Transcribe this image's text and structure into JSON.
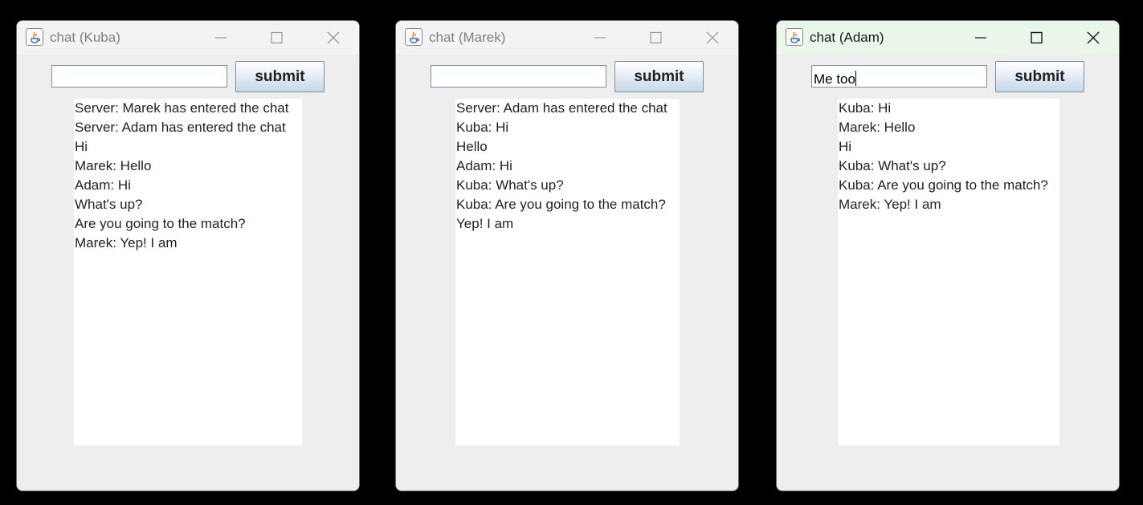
{
  "windows": [
    {
      "title": "chat (Kuba)",
      "input_value": "",
      "submit_label": "submit",
      "messages": [
        "Server: Marek has entered the chat",
        "Server: Adam has entered the chat",
        "Hi",
        "Marek: Hello",
        "Adam: Hi",
        "What's up?",
        "Are you going to the match?",
        "Marek: Yep! I am"
      ]
    },
    {
      "title": "chat (Marek)",
      "input_value": "",
      "submit_label": "submit",
      "messages": [
        "Server: Adam has entered the chat",
        "Kuba: Hi",
        "Hello",
        "Adam: Hi",
        "Kuba: What's up?",
        "Kuba: Are you going to the match?",
        "Yep! I am"
      ]
    },
    {
      "title": "chat (Adam)",
      "input_value": "Me too",
      "submit_label": "submit",
      "messages": [
        "Kuba: Hi",
        "Marek: Hello",
        "Hi",
        "Kuba: What's up?",
        "Kuba: Are you going to the match?",
        "Marek: Yep! I am"
      ]
    }
  ]
}
